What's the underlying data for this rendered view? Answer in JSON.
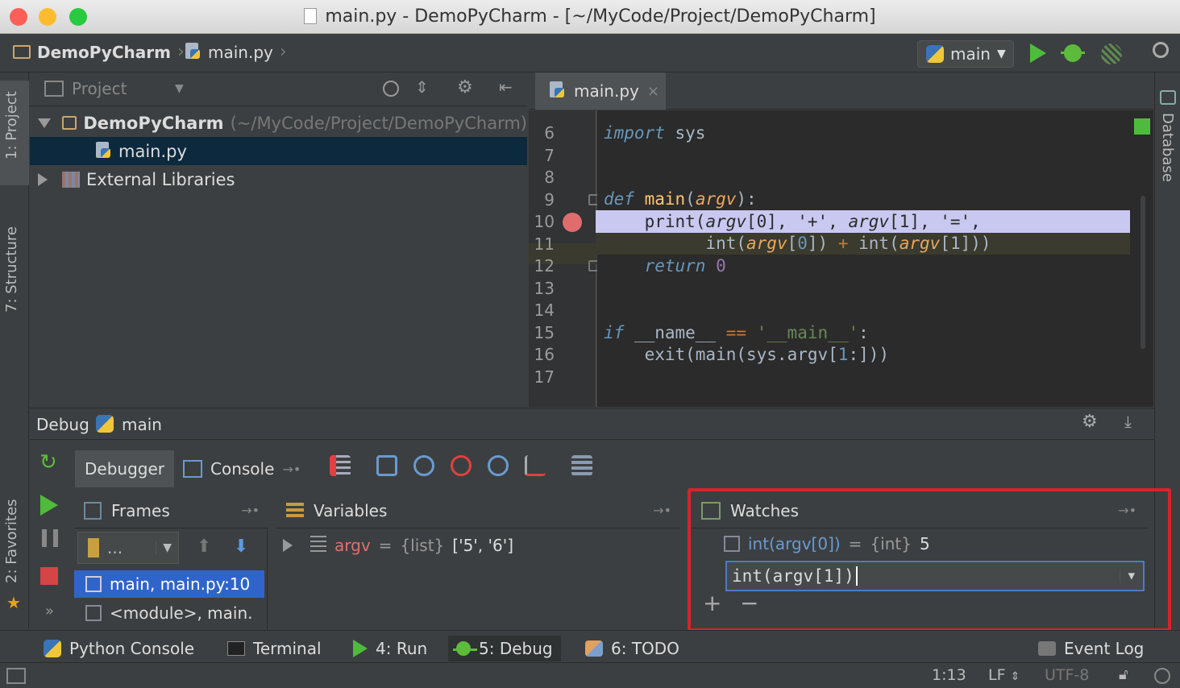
{
  "window": {
    "title": "main.py - DemoPyCharm - [~/MyCode/Project/DemoPyCharm]"
  },
  "navbar": {
    "crumbs": [
      "DemoPyCharm",
      "main.py"
    ],
    "run_config": "main"
  },
  "left_stripe": {
    "project_tab": "1: Project",
    "structure_tab": "7: Structure",
    "favorites_tab": "2: Favorites"
  },
  "right_stripe": {
    "database_tab": "Database"
  },
  "project": {
    "header_label": "Project",
    "root_name": "DemoPyCharm",
    "root_path": "(~/MyCode/Project/DemoPyCharm)",
    "file": "main.py",
    "libraries": "External Libraries"
  },
  "editor": {
    "tab": "main.py",
    "line_numbers": [
      "6",
      "7",
      "8",
      "9",
      "10",
      "11",
      "12",
      "13",
      "14",
      "15",
      "16",
      "17"
    ],
    "breakpoint_line": "10",
    "colors": {
      "highlight_line": "#c8c8f0",
      "breakpoint": "#e06c6c",
      "accent_green": "#4fbb3c"
    }
  },
  "debug": {
    "header": "Debug",
    "config": "main",
    "tabs": {
      "debugger": "Debugger",
      "console": "Console"
    },
    "frames": {
      "title": "Frames",
      "thread": "...",
      "items": [
        "main, main.py:10",
        "<module>, main."
      ]
    },
    "variables": {
      "title": "Variables",
      "items": [
        {
          "name": "argv",
          "eq": "=",
          "type": "{list}",
          "value": "['5', '6']"
        }
      ]
    },
    "watches": {
      "title": "Watches",
      "items": [
        {
          "expr": "int(argv[0])",
          "eq": "=",
          "type": "{int}",
          "value": "5"
        }
      ],
      "editing_value": "int(argv[1])",
      "add": "+",
      "remove": "−"
    }
  },
  "bottom_tools": {
    "python_console": "Python Console",
    "terminal": "Terminal",
    "run": "4: Run",
    "debug": "5: Debug",
    "todo": "6: TODO",
    "event_log": "Event Log"
  },
  "status": {
    "position": "1:13",
    "line_sep": "LF",
    "encoding": "UTF-8"
  }
}
